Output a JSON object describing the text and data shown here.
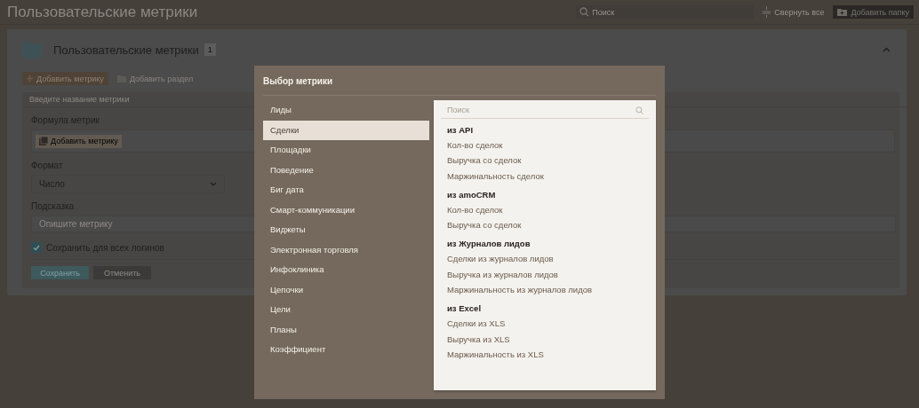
{
  "header": {
    "title": "Пользовательские метрики",
    "search": {
      "placeholder": "Поиск"
    },
    "collapse_button": "Свернуть все",
    "add_folder_button": "Добавить папку"
  },
  "section": {
    "title": "Пользовательские метрики",
    "count": "1",
    "expanded": true,
    "toolbar": {
      "add_metric_button": "Добавить метрику",
      "add_section_button": "Добавить раздел"
    },
    "form": {
      "name_field": {
        "placeholder": "Введите название метрики"
      },
      "formula_label": "Формула метрик",
      "formula_add_button": "Добавить метрику",
      "format_label": "Формат",
      "format_value": "Число",
      "hint_label": "Подсказка",
      "hint_field": {
        "placeholder": "Опишите метрику"
      },
      "save_all_logins": {
        "label": "Сохранить для всех логинов",
        "checked": true
      },
      "save_button": "Сохранить",
      "cancel_button": "Отменить"
    }
  },
  "modal": {
    "title": "Выбор метрики",
    "categories": [
      {
        "label": "Лиды",
        "selected": false
      },
      {
        "label": "Сделки",
        "selected": true
      },
      {
        "label": "Площадки",
        "selected": false
      },
      {
        "label": "Поведение",
        "selected": false
      },
      {
        "label": "Биг дата",
        "selected": false
      },
      {
        "label": "Смарт-коммуникации",
        "selected": false
      },
      {
        "label": "Виджеты",
        "selected": false
      },
      {
        "label": "Электронная торговля",
        "selected": false
      },
      {
        "label": "Инфоклиника",
        "selected": false
      },
      {
        "label": "Цепочки",
        "selected": false
      },
      {
        "label": "Цели",
        "selected": false
      },
      {
        "label": "Планы",
        "selected": false
      },
      {
        "label": "Коэффициент",
        "selected": false
      }
    ],
    "search": {
      "placeholder": "Поиск"
    },
    "groups": [
      {
        "title": "из API",
        "items": [
          "Кол-во сделок",
          "Выручка со сделок",
          "Маржинальность сделок"
        ]
      },
      {
        "title": "из amoCRM",
        "items": [
          "Кол-во сделок",
          "Выручка со сделок"
        ]
      },
      {
        "title": "из Журналов лидов",
        "items": [
          "Сделки из журналов лидов",
          "Выручка из журналов лидов",
          "Маржинальность из журналов лидов"
        ]
      },
      {
        "title": "из Excel",
        "items": [
          "Сделки из XLS",
          "Выручка из XLS",
          "Маржинальность из XLS"
        ]
      }
    ]
  }
}
